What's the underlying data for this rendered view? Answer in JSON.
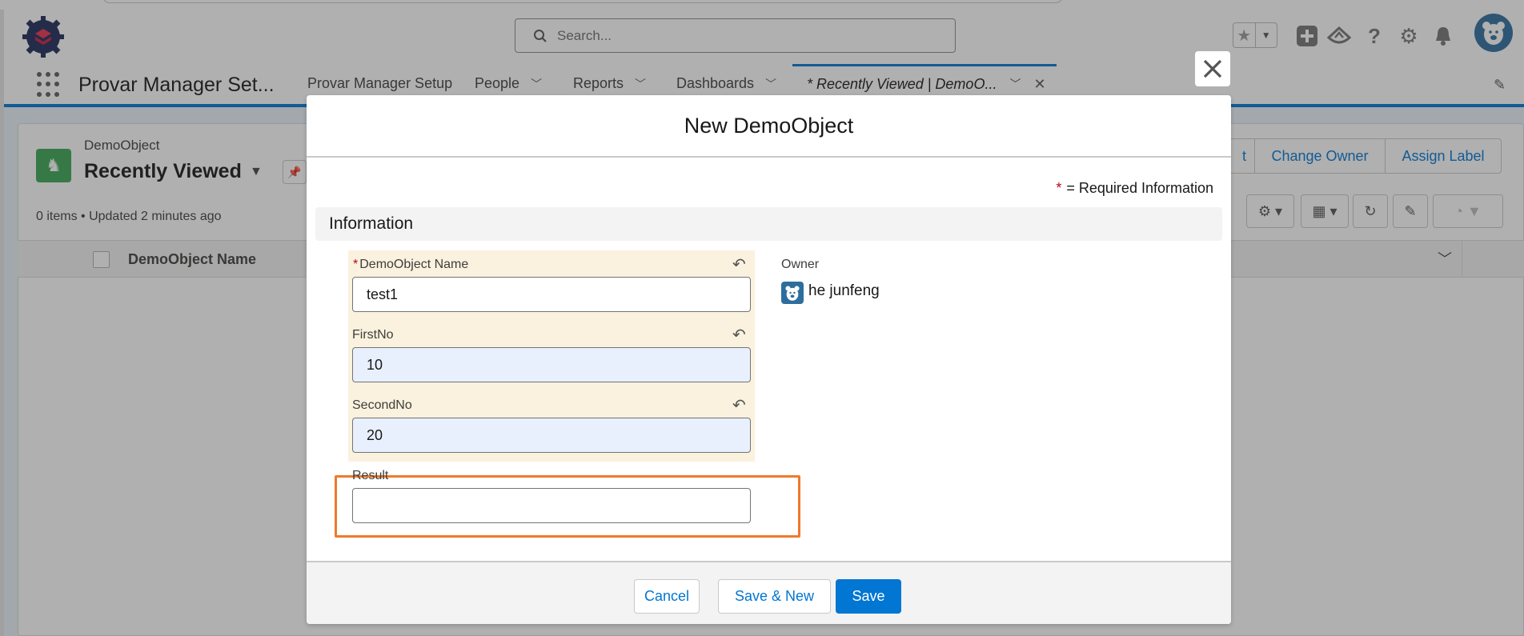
{
  "header": {
    "search_placeholder": "Search..."
  },
  "nav": {
    "app_name": "Provar Manager Set...",
    "items": [
      {
        "label": "Provar Manager Setup"
      },
      {
        "label": "People"
      },
      {
        "label": "Reports"
      },
      {
        "label": "Dashboards"
      }
    ],
    "active_tab_label": "* Recently Viewed | DemoO..."
  },
  "list_view": {
    "object_type": "DemoObject",
    "name": "Recently Viewed",
    "meta": "0 items • Updated 2 minutes ago",
    "header_buttons": [
      "t",
      "Change Owner",
      "Assign Label"
    ],
    "columns": [
      {
        "label": "DemoObject Name"
      }
    ]
  },
  "modal": {
    "title": "New DemoObject",
    "required_legend": "= Required Information",
    "required_star": "*",
    "section_title": "Information",
    "fields": {
      "name": {
        "label": "DemoObject Name",
        "value": "test1"
      },
      "first_no": {
        "label": "FirstNo",
        "value": "10"
      },
      "second_no": {
        "label": "SecondNo",
        "value": "20"
      },
      "result": {
        "label": "Result",
        "value": ""
      }
    },
    "owner": {
      "label": "Owner",
      "name": "he junfeng"
    },
    "buttons": {
      "cancel": "Cancel",
      "save_new": "Save & New",
      "save": "Save"
    }
  },
  "colors": {
    "brand": "#0176d3",
    "changed_field_bg": "#faf1de",
    "highlight": "#f0792a",
    "required": "#ba0517"
  }
}
